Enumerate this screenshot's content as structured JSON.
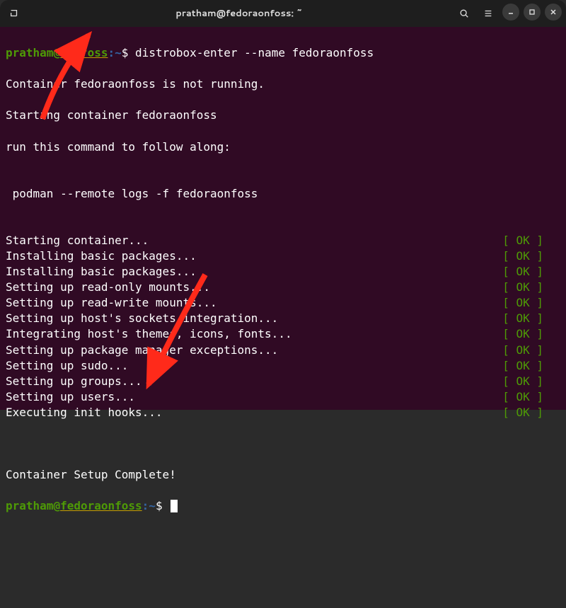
{
  "titlebar": {
    "title": "pratham@fedoraonfoss: ~"
  },
  "prompt1": {
    "user": "pratham",
    "at": "@",
    "host": "itsfoss",
    "path": ":~",
    "dollar": "$ ",
    "cmd": "distrobox-enter --name fedoraonfoss"
  },
  "lines": {
    "l1": "Container fedoraonfoss is not running.",
    "l2": "Starting container fedoraonfoss",
    "l3": "run this command to follow along:",
    "l4": "",
    "l5": " podman --remote logs -f fedoraonfoss",
    "l6": ""
  },
  "steps": [
    {
      "label": "Starting container...",
      "status": "[ OK ]"
    },
    {
      "label": "Installing basic packages...",
      "status": "[ OK ]"
    },
    {
      "label": "Installing basic packages...",
      "status": "[ OK ]"
    },
    {
      "label": "Setting up read-only mounts...",
      "status": "[ OK ]"
    },
    {
      "label": "Setting up read-write mounts...",
      "status": "[ OK ]"
    },
    {
      "label": "Setting up host's sockets integration...",
      "status": "[ OK ]"
    },
    {
      "label": "Integrating host's themes, icons, fonts...",
      "status": "[ OK ]"
    },
    {
      "label": "Setting up package manager exceptions...",
      "status": "[ OK ]"
    },
    {
      "label": "Setting up sudo...",
      "status": "[ OK ]"
    },
    {
      "label": "Setting up groups...",
      "status": "[ OK ]"
    },
    {
      "label": "Setting up users...",
      "status": "[ OK ]"
    },
    {
      "label": "Executing init hooks...",
      "status": "[ OK ]"
    }
  ],
  "complete": "Container Setup Complete!",
  "prompt2": {
    "user": "pratham",
    "at": "@",
    "host": "fedoraonfoss",
    "path": ":~",
    "dollar": "$ "
  },
  "ok": {
    "l": "[ ",
    "t": "OK",
    "r": " ]"
  }
}
